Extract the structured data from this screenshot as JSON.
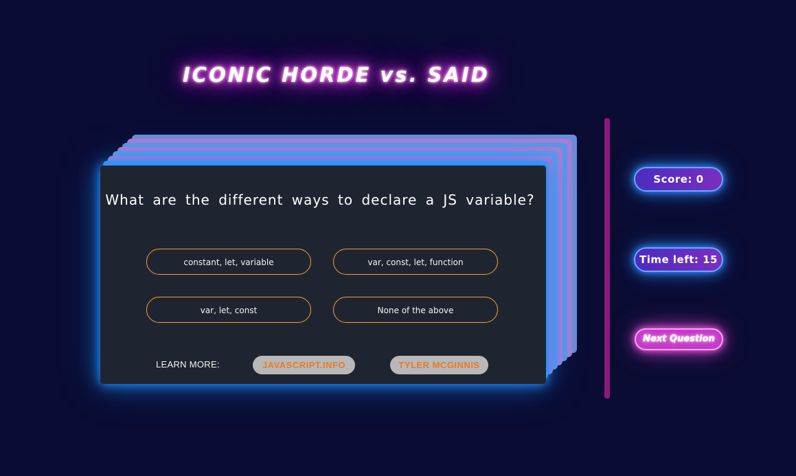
{
  "title": "ICONIC HORDE vs. SAID",
  "question": "What are the different ways to declare a JS variable?",
  "answers": [
    "constant, let, variable",
    "var, const, let, function",
    "var, let, const",
    "None of the above"
  ],
  "learn_more": {
    "label": "LEARN MORE:",
    "links": [
      "JAVASCRIPT.INFO",
      "TYLER MCGINNIS"
    ]
  },
  "sidebar": {
    "score": "Score: 0",
    "time_left": "Time left: 15",
    "next_button": "Next Question"
  },
  "colors": {
    "background": "#0a0c33",
    "card": "#1f2530",
    "answer_border": "#f0a23a",
    "link_text": "#e47d26",
    "divider": "#8b1a7c",
    "pill_glow": "#2f8cff",
    "next_button": "#c53bc8"
  }
}
